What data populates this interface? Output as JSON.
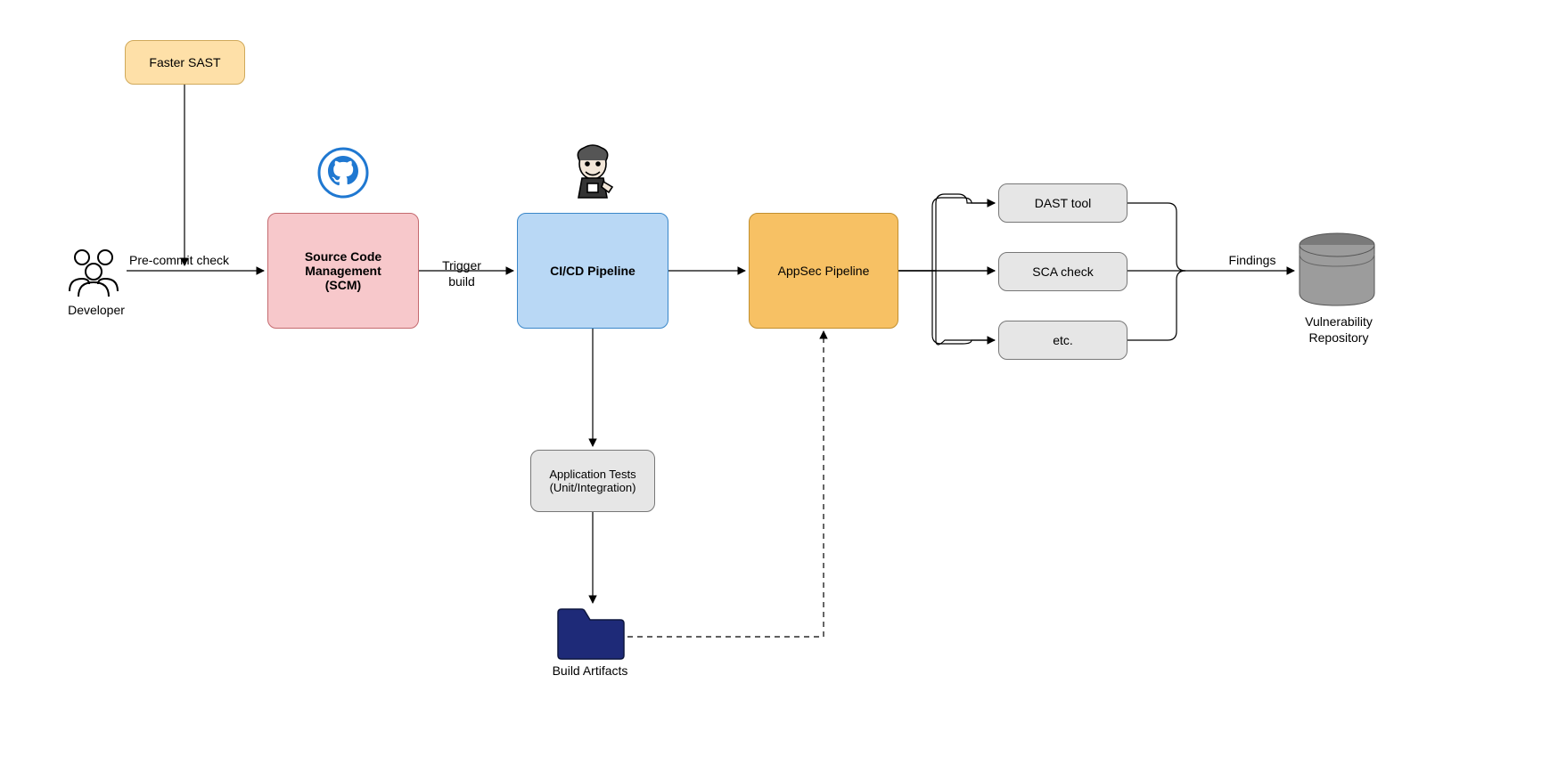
{
  "nodes": {
    "faster_sast": "Faster SAST",
    "developer": "Developer",
    "scm": "Source Code\nManagement\n(SCM)",
    "cicd": "CI/CD Pipeline",
    "appsec": "AppSec Pipeline",
    "app_tests": "Application Tests\n(Unit/Integration)",
    "build_artifacts": "Build Artifacts",
    "dast": "DAST tool",
    "sca": "SCA check",
    "etc": "etc.",
    "vuln_repo": "Vulnerability\nRepository"
  },
  "edges": {
    "precommit": "Pre-commit check",
    "trigger": "Trigger\nbuild",
    "findings": "Findings"
  },
  "colors": {
    "sast_bg": "#fee0a8",
    "sast_border": "#d0a95a",
    "scm_bg": "#f7c8cb",
    "scm_border": "#c46a6f",
    "cicd_bg": "#b9d8f5",
    "cicd_border": "#3a87c9",
    "appsec_bg": "#f7c164",
    "appsec_border": "#c28f2f",
    "grey_bg": "#e6e6e6",
    "grey_border": "#777",
    "github": "#1f78d1",
    "folder": "#1e2a78",
    "db_top": "#7a7a7a",
    "db_body": "#9c9c9c"
  }
}
